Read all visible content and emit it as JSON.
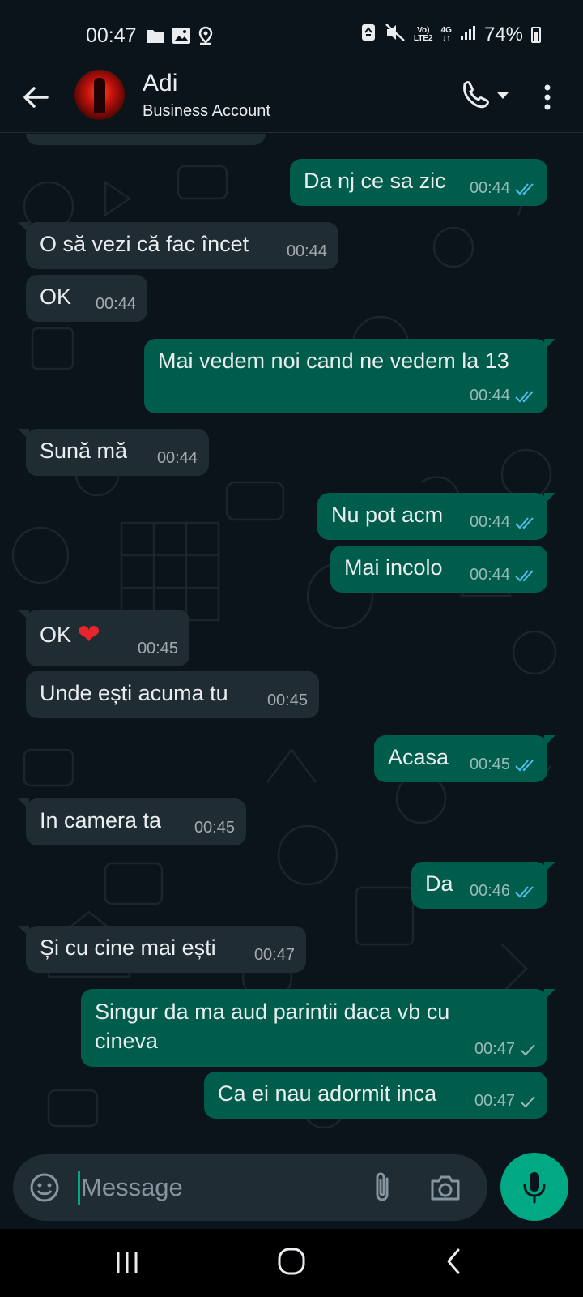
{
  "status_bar": {
    "time": "00:47",
    "network_lines": [
      "Vo)",
      "LTE2"
    ],
    "network_gen": "4G",
    "battery": "74%",
    "left_icons": [
      "folder-icon",
      "image-icon",
      "location-icon"
    ],
    "right_icons": [
      "recycle-icon",
      "mute-icon",
      "signal-icon",
      "battery-icon"
    ]
  },
  "header": {
    "contact_name": "Adi",
    "subtitle": "Business Account"
  },
  "messages": [
    {
      "dir": "out",
      "text": "Da nj ce sa zic",
      "time": "00:44",
      "ticks": "read"
    },
    {
      "dir": "in",
      "text": "O să vezi că fac încet",
      "time": "00:44"
    },
    {
      "dir": "in",
      "text": "OK",
      "time": "00:44"
    },
    {
      "dir": "out",
      "text": "Mai vedem noi cand ne vedem la 13",
      "time": "00:44",
      "ticks": "read"
    },
    {
      "dir": "in",
      "text": "Sună mă",
      "time": "00:44"
    },
    {
      "dir": "out",
      "text": "Nu pot acm",
      "time": "00:44",
      "ticks": "read"
    },
    {
      "dir": "out",
      "text": "Mai incolo",
      "time": "00:44",
      "ticks": "read"
    },
    {
      "dir": "in",
      "text": "OK",
      "emoji": "❤",
      "time": "00:45"
    },
    {
      "dir": "in",
      "text": "Unde ești acuma tu",
      "time": "00:45"
    },
    {
      "dir": "out",
      "text": "Acasa",
      "time": "00:45",
      "ticks": "read"
    },
    {
      "dir": "in",
      "text": "In camera ta",
      "time": "00:45"
    },
    {
      "dir": "out",
      "text": "Da",
      "time": "00:46",
      "ticks": "read"
    },
    {
      "dir": "in",
      "text": "Și cu cine mai ești",
      "time": "00:47"
    },
    {
      "dir": "out",
      "text": "Singur da ma aud parintii daca vb cu cineva",
      "time": "00:47",
      "ticks": "sent"
    },
    {
      "dir": "out",
      "text": "Ca ei nau adormit inca",
      "time": "00:47",
      "ticks": "sent"
    }
  ],
  "input": {
    "placeholder": "Message"
  },
  "colors": {
    "background": "#0b141a",
    "incoming_bubble": "#202c33",
    "outgoing_bubble": "#005c4b",
    "accent": "#00a884",
    "read_tick": "#53bdeb"
  }
}
